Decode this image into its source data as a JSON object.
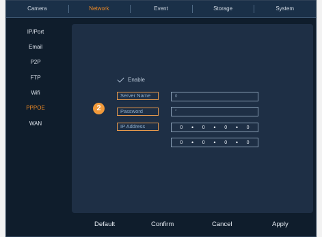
{
  "tabs": [
    {
      "label": "Camera",
      "active": false
    },
    {
      "label": "Network",
      "active": true
    },
    {
      "label": "Event",
      "active": false
    },
    {
      "label": "Storage",
      "active": false
    },
    {
      "label": "System",
      "active": false
    }
  ],
  "sidebar": {
    "items": [
      {
        "label": "IP/Port"
      },
      {
        "label": "Email"
      },
      {
        "label": "P2P"
      },
      {
        "label": "FTP"
      },
      {
        "label": "Wifi"
      },
      {
        "label": "PPPOE",
        "active": true
      },
      {
        "label": "WAN"
      }
    ]
  },
  "form": {
    "enable_label": "Enable",
    "badge": "2",
    "server_name_label": "Server Name",
    "server_name_value": "0",
    "password_label": "Password",
    "password_value": "*",
    "ip_address_label": "IP Address",
    "ip_address": [
      "0",
      "0",
      "0",
      "0"
    ],
    "ip_address_2": [
      "0",
      "0",
      "0",
      "0"
    ]
  },
  "footer": {
    "default_label": "Default",
    "confirm_label": "Confirm",
    "cancel_label": "Cancel",
    "apply_label": "Apply"
  },
  "colors": {
    "accent": "#f08a24",
    "background": "#0f1d2c",
    "panel": "#1e2f45"
  }
}
